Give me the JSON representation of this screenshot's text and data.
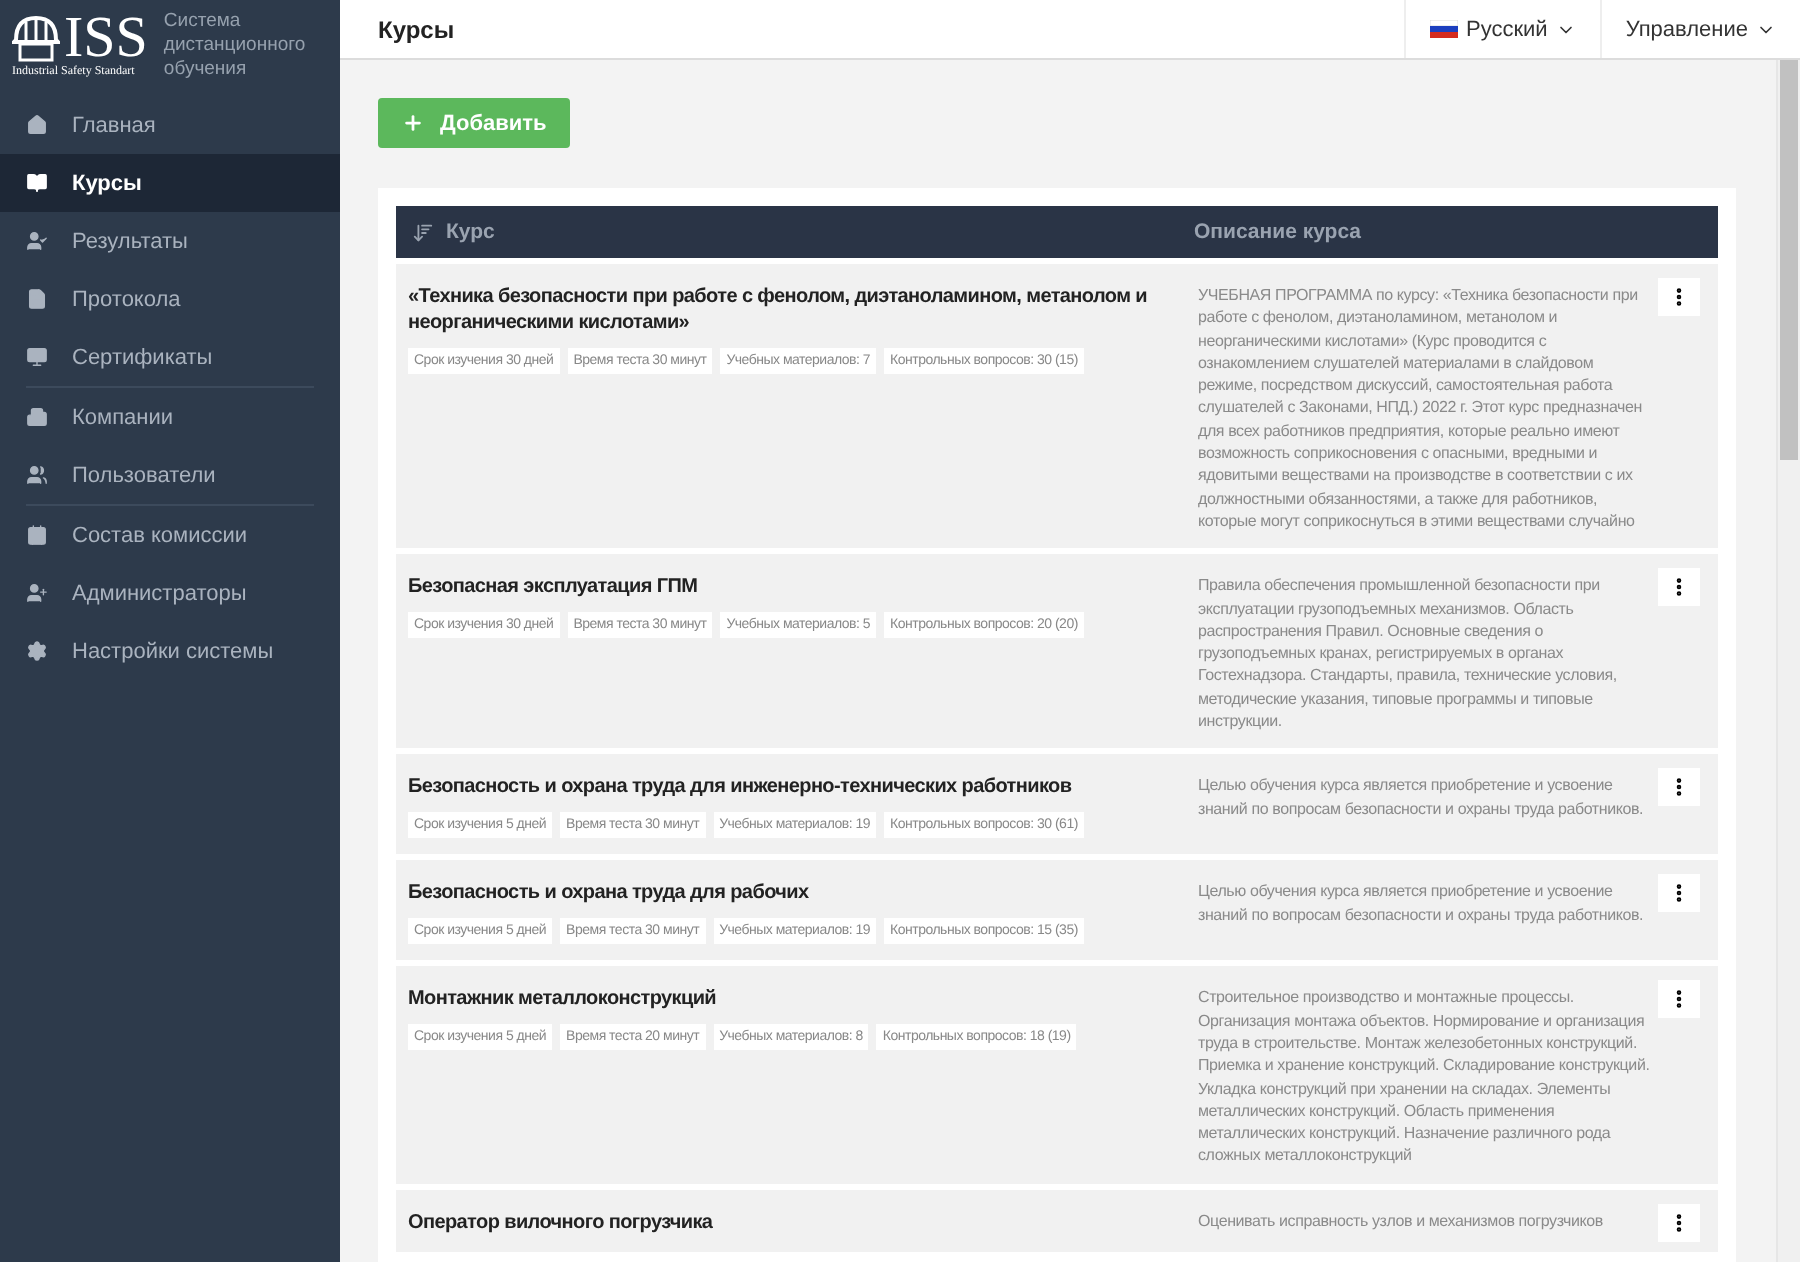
{
  "sidebar": {
    "logo": {
      "name": "ISS",
      "tagline": "Industrial Safety Standart"
    },
    "subtitle": "Система дистанционного обучения",
    "sections": [
      {
        "items": [
          {
            "label": "Главная",
            "selected": false
          },
          {
            "label": "Курсы",
            "selected": true
          },
          {
            "label": "Результаты",
            "selected": false
          },
          {
            "label": "Протокола",
            "selected": false
          },
          {
            "label": "Сертификаты",
            "selected": false
          }
        ]
      },
      {
        "items": [
          {
            "label": "Компании",
            "selected": false
          },
          {
            "label": "Пользователи",
            "selected": false
          }
        ]
      },
      {
        "items": [
          {
            "label": "Состав комиссии",
            "selected": false
          },
          {
            "label": "Администраторы",
            "selected": false
          },
          {
            "label": "Настройки системы",
            "selected": false
          }
        ]
      }
    ]
  },
  "header": {
    "title": "Курсы",
    "language": "Русский",
    "menu": "Управление"
  },
  "add_button": "Добавить",
  "table": {
    "columns": [
      "Курс",
      "Описание курса"
    ],
    "rows": [
      {
        "title": "«Техника безопасности при работе с фенолом, диэтаноламином, метанолом и неорганическими кислотами»",
        "tags": [
          "Срок изучения 30 дней",
          "Время теста 30 минут",
          "Учебных материалов: 7",
          "Контрольных вопросов: 30 (15)"
        ],
        "description": "УЧЕБНАЯ ПРОГРАММА по курсу: «Техника безопасности при работе с фенолом, диэтаноламином, метанолом и неорганическими кислотами» (Курс проводится с ознакомлением слушателей материалами в слайдовом режиме, посредством дискуссий, самостоятельная работа слушателей с Законами, НПД.) 2022 г. Этот курс предназначен для всех работников предприятия, которые реально имеют возможность соприкосновения с опасными, вредными и ядовитыми веществами на производстве в соответствии с их должностными обязанностями, а также для работников, которые могут соприкоснуться в этими веществами случайно"
      },
      {
        "title": "Безопасная эксплуатация ГПМ",
        "tags": [
          "Срок изучения 30 дней",
          "Время теста 30 минут",
          "Учебных материалов: 5",
          "Контрольных вопросов: 20 (20)"
        ],
        "description": "Правила обеспечения промышленной безопасности при эксплуатации грузоподъемных механизмов. Область распространения Правил. Основные сведения о грузоподъемных кранах, регистрируемых в органах Гостехнадзора. Стандарты, правила, технические условия, методические указания, типовые программы и типовые инструкции."
      },
      {
        "title": "Безопасность и охрана труда для инженерно-технических работников",
        "tags": [
          "Срок изучения 5 дней",
          "Время теста 30 минут",
          "Учебных материалов: 19",
          "Контрольных вопросов: 30 (61)"
        ],
        "description": "Целью обучения курса является приобретение и усвоение знаний по вопросам безопасности и охраны труда работников."
      },
      {
        "title": "Безопасность и охрана труда для рабочих",
        "tags": [
          "Срок изучения 5 дней",
          "Время теста 30 минут",
          "Учебных материалов: 19",
          "Контрольных вопросов: 15 (35)"
        ],
        "description": "Целью обучения курса является приобретение и усвоение знаний по вопросам безопасности и охраны труда работников."
      },
      {
        "title": "Монтажник металлоконструкций",
        "tags": [
          "Срок изучения 5 дней",
          "Время теста 20 минут",
          "Учебных материалов: 8",
          "Контрольных вопросов: 18 (19)"
        ],
        "description": "Строительное производство и монтажные процессы. Организация монтажа объектов. Нормирование и организация труда в строительстве. Монтаж железобетонных конструкций. Приемка и хранение конструкций. Складирование конструкций. Укладка конструкций при хранении на складах. Элементы металлических конструкций. Область применения металлических конструкций. Назначение различного рода сложных металлоконструкций"
      },
      {
        "title": "Оператор вилочного погрузчика",
        "description": "Оценивать исправность узлов и механизмов погрузчиков"
      }
    ]
  }
}
